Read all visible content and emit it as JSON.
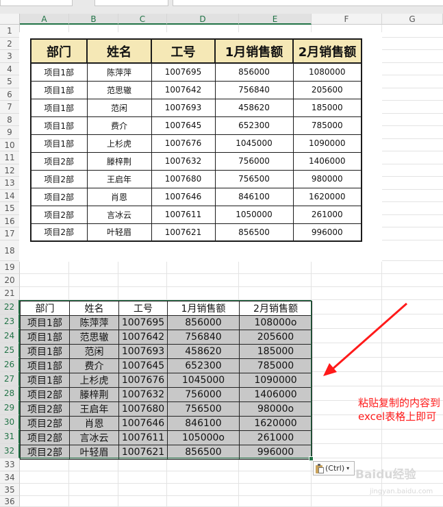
{
  "columns": [
    "A",
    "B",
    "C",
    "D",
    "E",
    "F",
    "G"
  ],
  "rows": [
    "1",
    "2",
    "3",
    "4",
    "5",
    "6",
    "7",
    "8",
    "9",
    "10",
    "11",
    "12",
    "13",
    "14",
    "15",
    "16",
    "17",
    "18",
    "19",
    "20",
    "21",
    "22",
    "23",
    "24",
    "25",
    "26",
    "27",
    "28",
    "29",
    "30",
    "31",
    "32",
    "33",
    "34",
    "35",
    "36"
  ],
  "image_table": {
    "headers": [
      "部门",
      "姓名",
      "工号",
      "1月销售额",
      "2月销售额"
    ],
    "rows": [
      [
        "项目1部",
        "陈萍萍",
        "1007695",
        "856000",
        "1080000"
      ],
      [
        "项目1部",
        "范思辙",
        "1007642",
        "756840",
        "205600"
      ],
      [
        "项目1部",
        "范闲",
        "1007693",
        "458620",
        "185000"
      ],
      [
        "项目1部",
        "费介",
        "1007645",
        "652300",
        "785000"
      ],
      [
        "项目1部",
        "上杉虎",
        "1007676",
        "1045000",
        "1090000"
      ],
      [
        "项目2部",
        "滕梓荆",
        "1007632",
        "756000",
        "1406000"
      ],
      [
        "项目2部",
        "王启年",
        "1007680",
        "756500",
        "980000"
      ],
      [
        "项目2部",
        "肖恩",
        "1007646",
        "846100",
        "1620000"
      ],
      [
        "项目2部",
        "言冰云",
        "1007611",
        "1050000",
        "261000"
      ],
      [
        "项目2部",
        "叶轻眉",
        "1007621",
        "856500",
        "996000"
      ]
    ]
  },
  "pasted_table": {
    "headers": [
      "部门",
      "姓名",
      "工号",
      "1月销售额",
      "2月销售额"
    ],
    "rows": [
      [
        "项目1部",
        "陈萍萍",
        "1007695",
        "856000",
        "108000o"
      ],
      [
        "项目1部",
        "范思辙",
        "1007642",
        "756840",
        "205600"
      ],
      [
        "项目1部",
        "范闲",
        "1007693",
        "458620",
        "185000"
      ],
      [
        "项目1部",
        "费介",
        "1007645",
        "652300",
        "785000"
      ],
      [
        "项目1部",
        "上杉虎",
        "1007676",
        "1045000",
        "1090000"
      ],
      [
        "项目2部",
        "滕梓荆",
        "1007632",
        "756000",
        "1406000"
      ],
      [
        "项目2部",
        "王启年",
        "1007680",
        "756500",
        "98000o"
      ],
      [
        "项目2部",
        "肖恩",
        "1007646",
        "846100",
        "1620000"
      ],
      [
        "项目2部",
        "言冰云",
        "1007611",
        "105000o",
        "261000"
      ],
      [
        "项目2部",
        "叶轻眉",
        "1007621",
        "856500",
        "996000"
      ]
    ]
  },
  "paste_options": {
    "label": "(Ctrl)",
    "caret": "▾"
  },
  "annotation": {
    "text": "粘贴复制的内容到excel表格上即可",
    "color": "#ff1a1a"
  },
  "watermark": {
    "text": "Baidu经验",
    "url_text": "jingyan.baidu.com"
  },
  "colors": {
    "accent": "#217346",
    "header_fill": "#f5e8b6",
    "pasted_fill": "#c8c8c8"
  }
}
